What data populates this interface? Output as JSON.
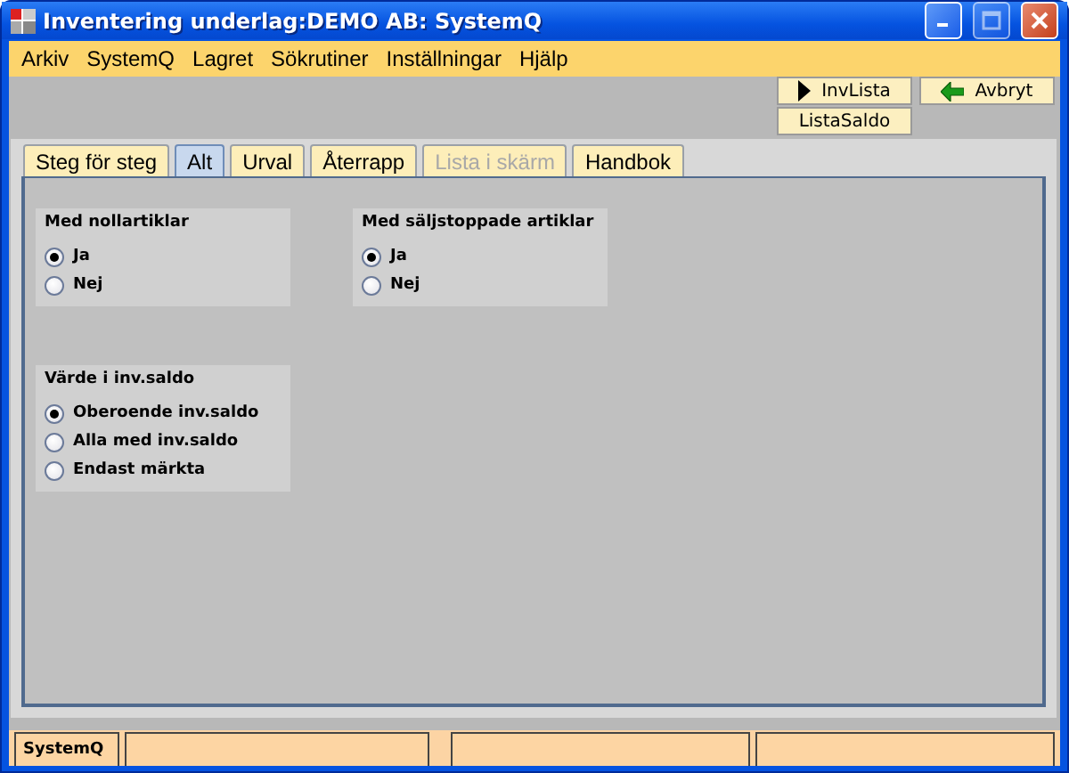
{
  "window": {
    "title": "Inventering underlag:DEMO AB: SystemQ"
  },
  "menu": [
    "Arkiv",
    "SystemQ",
    "Lagret",
    "Sökrutiner",
    "Inställningar",
    "Hjälp"
  ],
  "toolbar": [
    {
      "label": "InvLista",
      "kind": "play"
    },
    {
      "label": "Avbryt",
      "kind": "back"
    },
    {
      "label": "ListaSaldo",
      "kind": "plain"
    }
  ],
  "tabs": [
    {
      "label": "Steg för steg",
      "selected": false,
      "disabled": false
    },
    {
      "label": "Alt",
      "selected": true,
      "disabled": false
    },
    {
      "label": "Urval",
      "selected": false,
      "disabled": false
    },
    {
      "label": "Återrapp",
      "selected": false,
      "disabled": false
    },
    {
      "label": "Lista i skärm",
      "selected": false,
      "disabled": true
    },
    {
      "label": "Handbok",
      "selected": false,
      "disabled": false
    }
  ],
  "groups": [
    {
      "title": "Med nollartiklar",
      "options": [
        {
          "label": "Ja",
          "selected": true
        },
        {
          "label": "Nej",
          "selected": false
        }
      ]
    },
    {
      "title": "Med säljstoppade artiklar",
      "options": [
        {
          "label": "Ja",
          "selected": true
        },
        {
          "label": "Nej",
          "selected": false
        }
      ]
    },
    {
      "title": "Värde i inv.saldo",
      "options": [
        {
          "label": "Oberoende inv.saldo",
          "selected": true
        },
        {
          "label": "Alla med inv.saldo",
          "selected": false
        },
        {
          "label": "Endast märkta",
          "selected": false
        }
      ]
    }
  ],
  "status_bar": {
    "text": "SystemQ"
  }
}
